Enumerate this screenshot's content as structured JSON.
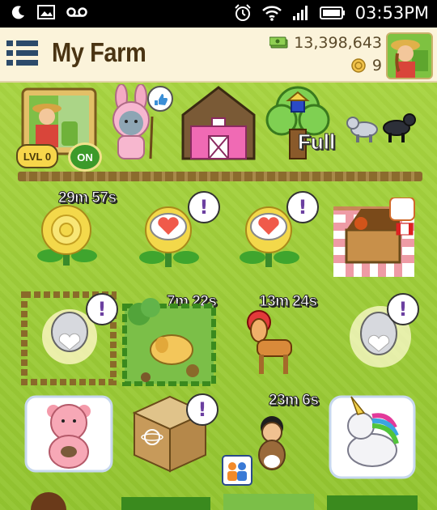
{
  "status_bar": {
    "time": "03:53PM",
    "icons": [
      "moon-icon",
      "image-icon",
      "voicemail-icon",
      "alarm-icon",
      "wifi-icon",
      "signal-icon",
      "battery-icon"
    ]
  },
  "header": {
    "title": "My Farm",
    "cash": "13,398,643",
    "coins": "9"
  },
  "farm": {
    "farmer_level": "LVL 0",
    "farmer_toggle": "ON",
    "tree_status": "Full",
    "timers": [
      "29m 57s",
      "7m 22s",
      "13m 24s",
      "23m 6s"
    ],
    "alert_mark": "!"
  },
  "colors": {
    "grass": "#9ccc3c",
    "header_bg": "#fbf3da",
    "alert_purple": "#6b3fa0",
    "title_brown": "#4a3413"
  }
}
